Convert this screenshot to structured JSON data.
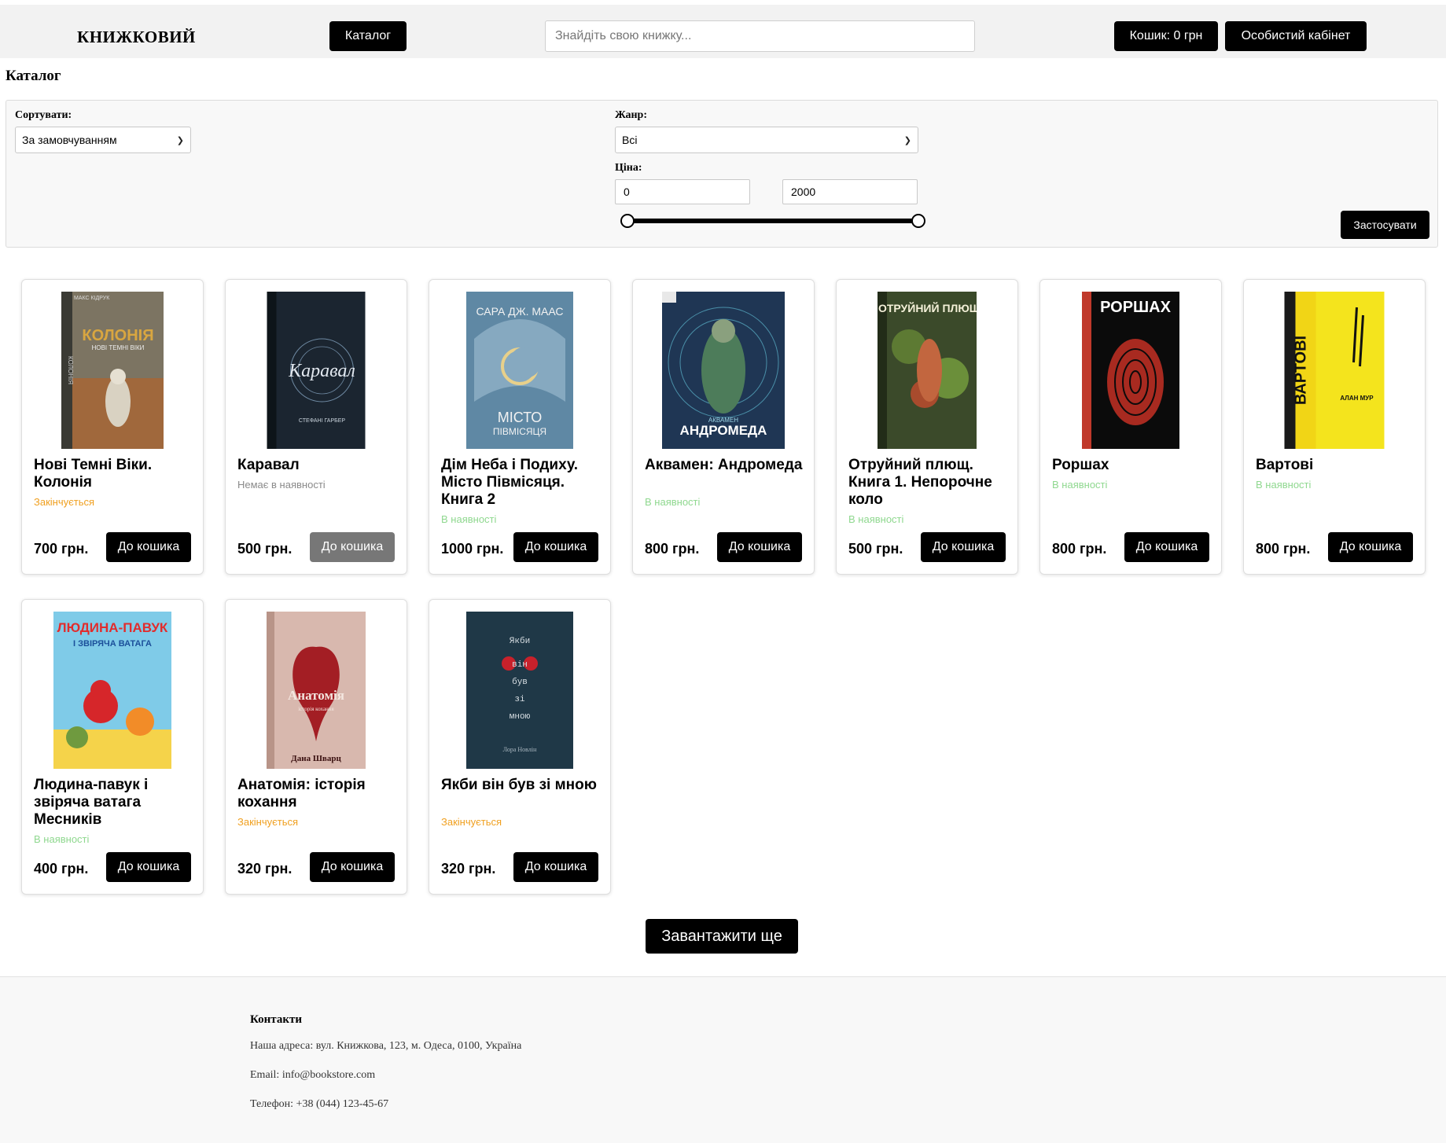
{
  "header": {
    "logo": "КНИЖКОВИЙ",
    "catalog_button": "Каталог",
    "search_placeholder": "Знайдіть свою книжку...",
    "cart_button": "Кошик: 0 грн",
    "account_button": "Особистий кабінет"
  },
  "page": {
    "title": "Каталог"
  },
  "filters": {
    "sort_label": "Сортувати:",
    "sort_value": "За замовчуванням",
    "genre_label": "Жанр:",
    "genre_value": "Всі",
    "price_label": "Ціна:",
    "price_min": "0",
    "price_max": "2000",
    "slider_min_fraction": 0,
    "slider_max_fraction": 1,
    "apply_button": "Застосувати"
  },
  "books": [
    {
      "title": "Нові Темні Віки. Колонія",
      "status": "Закінчується",
      "status_type": "low",
      "price": "700 грн.",
      "button": "До кошика",
      "available": true,
      "cover": "kolonia-cover"
    },
    {
      "title": "Каравал",
      "status": "Немає в наявності",
      "status_type": "out",
      "price": "500 грн.",
      "button": "До кошика",
      "available": false,
      "cover": "karaval-cover"
    },
    {
      "title": "Дім Неба і Подиху. Місто Півмісяця. Книга 2",
      "status": "В наявності",
      "status_type": "in",
      "price": "1000 грн.",
      "button": "До кошика",
      "available": true,
      "cover": "misto-pivmisiatsia-cover"
    },
    {
      "title": "Аквамен: Андромеда",
      "status": "В наявності",
      "status_type": "in",
      "price": "800 грн.",
      "button": "До кошика",
      "available": true,
      "cover": "aquaman-cover"
    },
    {
      "title": "Отруйний плющ. Книга 1. Непорочне коло",
      "status": "В наявності",
      "status_type": "in",
      "price": "500 грн.",
      "button": "До кошика",
      "available": true,
      "cover": "poison-ivy-cover"
    },
    {
      "title": "Роршах",
      "status": "В наявності",
      "status_type": "in",
      "price": "800 грн.",
      "button": "До кошика",
      "available": true,
      "cover": "rorschach-cover"
    },
    {
      "title": "Вартові",
      "status": "В наявності",
      "status_type": "in",
      "price": "800 грн.",
      "button": "До кошика",
      "available": true,
      "cover": "watchmen-cover"
    },
    {
      "title": "Людина-павук і звіряча ватага Месників",
      "status": "В наявності",
      "status_type": "in",
      "price": "400 грн.",
      "button": "До кошика",
      "available": true,
      "cover": "spiderman-cover"
    },
    {
      "title": "Анатомія: історія кохання",
      "status": "Закінчується",
      "status_type": "low",
      "price": "320 грн.",
      "button": "До кошика",
      "available": true,
      "cover": "anatomy-cover"
    },
    {
      "title": "Якби він був зі мною",
      "status": "Закінчується",
      "status_type": "low",
      "price": "320 грн.",
      "button": "До кошика",
      "available": true,
      "cover": "yakby-vin-buv-cover"
    }
  ],
  "covers": {
    "kolonia": {
      "title": "КОЛОНІЯ",
      "subtitle": "НОВІ ТЕМНІ ВІКИ",
      "author": "МАКС КІДРУК",
      "spine": "КОЛОНІЯ"
    },
    "karaval": {
      "title": "Каравал",
      "author": "СТЕФАНІ ГАРБЕР"
    },
    "misto": {
      "author": "САРА ДЖ. МААС",
      "title": "МІСТО",
      "title2": "ПІВМІСЯЦЯ"
    },
    "aquaman": {
      "title": "АНДРОМЕДА",
      "overline": "АКВАМЕН"
    },
    "ivy": {
      "title": "ОТРУЙНИЙ ПЛЮЩ"
    },
    "rorschach": {
      "title": "РОРШАХ"
    },
    "watchmen": {
      "title": "ВАРТОВІ",
      "author": "АЛАН МУР"
    },
    "spiderman": {
      "title": "ЛЮДИНА-ПАВУК",
      "subtitle": "І ЗВІРЯЧА ВАТАГА"
    },
    "anatomy": {
      "title": "Анатомія",
      "subtitle": "історія кохання",
      "author": "Дана Шварц"
    },
    "yakby": {
      "lines": [
        "Якби",
        "він",
        "був",
        "зі",
        "мною"
      ],
      "author": "Лора Новлін"
    }
  },
  "load_more_button": "Завантажити ще",
  "footer": {
    "title": "Контакти",
    "address": "Наша адреса: вул. Книжкова, 123, м. Одеса, 0100, Україна",
    "email": "Email: info@bookstore.com",
    "phone": "Телефон: +38 (044) 123-45-67"
  },
  "colors": {
    "accent": "#000000",
    "header_bg": "#f2f2f2",
    "status_low": "#f0a020",
    "status_out": "#8a8a8a",
    "status_in": "#8fd88f",
    "disabled_button": "#777777"
  }
}
